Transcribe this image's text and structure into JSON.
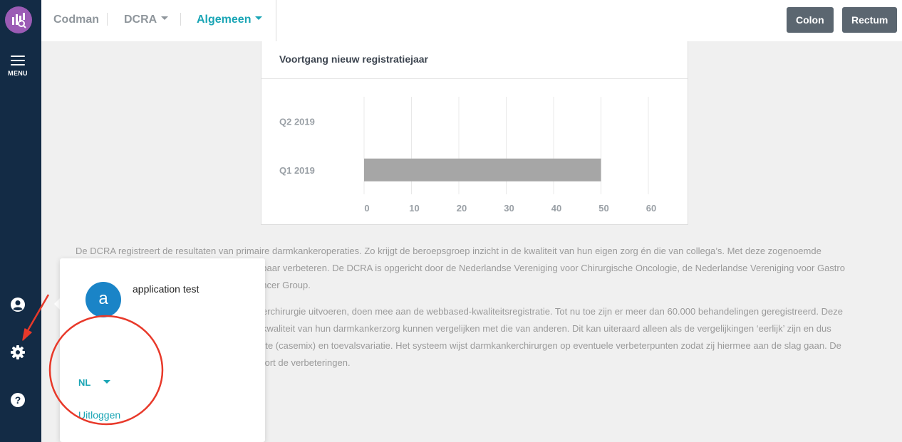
{
  "sidebar": {
    "menu_label": "MENU",
    "icons": [
      "logo-icon",
      "hamburger-icon",
      "account-icon",
      "gear-icon",
      "help-icon"
    ]
  },
  "topbar": {
    "nav": [
      {
        "label": "Codman"
      },
      {
        "label": "DCRA"
      },
      {
        "label": "Algemeen"
      }
    ],
    "buttons": [
      {
        "label": "Colon"
      },
      {
        "label": "Rectum"
      }
    ]
  },
  "card": {
    "title": "Voortgang nieuw registratiejaar"
  },
  "chart_data": {
    "type": "bar",
    "orientation": "horizontal",
    "title": "Voortgang nieuw registratiejaar",
    "categories": [
      "Q2 2019",
      "Q1 2019"
    ],
    "values": [
      0,
      50
    ],
    "xticks": [
      0,
      10,
      20,
      30,
      40,
      50,
      60
    ],
    "xlim": [
      0,
      60
    ],
    "grid": true,
    "bar_color": "#a6a6a6"
  },
  "body_text": {
    "p1_l1": "De DCRA registreert de resultaten van primaire darmkankeroperaties. Zo krijgt de beroepsgroep inzicht in de kwaliteit van hun eigen zorg én die van collega’s. Met deze zogenoemde",
    "p1_l2": "nbaar verbeteren. De DCRA is opgericht door de Nederlandse Vereniging voor Chirurgische Oncologie, de Nederlandse Vereniging voor Gastro",
    "p1_l3": "ancer Group.",
    "p2_l1": "erchirurgie uitvoeren, doen mee aan de webbased-kwaliteitsregistratie. Tot nu toe zijn er meer dan 60.000 behandelingen geregistreerd. Deze",
    "p2_l2": "kwaliteit van hun darmkankerzorg kunnen vergelijken met die van anderen. Dit kan uiteraard alleen als de vergelijkingen ‘eerlijk’ zijn en dus",
    "p2_l3": "rte (casemix) en toevalsvariatie. Het systeem wijst darmkankerchirurgen op eventuele verbeterpunten zodat zij hiermee aan de slag gaan. De",
    "p2_l4": "tort de verbeteringen."
  },
  "popover": {
    "avatar_letter": "a",
    "user_name": "application test",
    "language": "NL",
    "logout": "Uitloggen"
  },
  "colors": {
    "sidebar_bg": "#132b45",
    "accent": "#1aa5b5",
    "button_bg": "#5b6670",
    "avatar_bg": "#1a84c7",
    "annotation_red": "#e8392a"
  }
}
